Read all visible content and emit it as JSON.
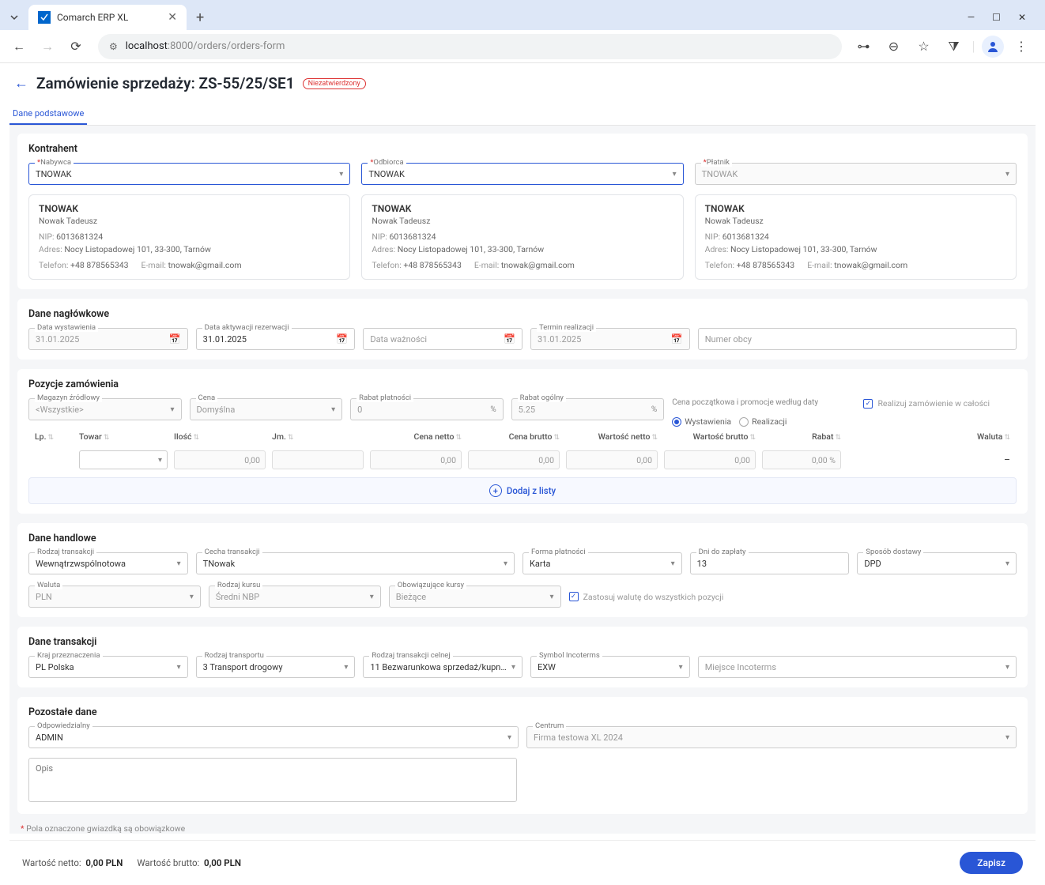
{
  "browser": {
    "tab_title": "Comarch ERP XL",
    "url_host": "localhost",
    "url_port": ":8000",
    "url_path": "/orders/orders-form"
  },
  "header": {
    "title": "Zamówienie sprzedaży: ZS-55/25/SE1",
    "badge": "Niezatwierdzony",
    "tab": "Dane podstawowe"
  },
  "kontrahent": {
    "title": "Kontrahent",
    "nabywca_label": "Nabywca",
    "odbiorca_label": "Odbiorca",
    "platnik_label": "Płatnik",
    "value": "TNOWAK",
    "card": {
      "name": "TNOWAK",
      "person": "Nowak Tadeusz",
      "nip_lbl": "NIP:",
      "nip": "6013681324",
      "adres_lbl": "Adres:",
      "adres": "Nocy Listopadowej 101, 33-300, Tarnów",
      "tel_lbl": "Telefon:",
      "tel": "+48 878565343",
      "email_lbl": "E-mail:",
      "email": "tnowak@gmail.com"
    }
  },
  "naglowkowe": {
    "title": "Dane nagłówkowe",
    "data_wyst_lbl": "Data wystawienia",
    "data_wyst": "31.01.2025",
    "data_akt_lbl": "Data aktywacji rezerwacji",
    "data_akt": "31.01.2025",
    "data_wazn_lbl": "Data ważności",
    "termin_lbl": "Termin realizacji",
    "termin": "31.01.2025",
    "numer_obcy_ph": "Numer obcy"
  },
  "pozycje": {
    "title": "Pozycje zamówienia",
    "magazyn_lbl": "Magazyn źródłowy",
    "magazyn": "<Wszystkie>",
    "cena_lbl": "Cena",
    "cena": "Domyślna",
    "rabat_p_lbl": "Rabat płatności",
    "rabat_p": "0",
    "rabat_o_lbl": "Rabat ogólny",
    "rabat_o": "5.25",
    "promo_title": "Cena początkowa i promocje według daty",
    "r_wyst": "Wystawienia",
    "r_real": "Realizacji",
    "realizuj": "Realizuj zamówienie w całości",
    "cols": {
      "lp": "Lp.",
      "towar": "Towar",
      "ilosc": "Ilość",
      "jm": "Jm.",
      "cn": "Cena netto",
      "cb": "Cena brutto",
      "wn": "Wartość netto",
      "wb": "Wartość brutto",
      "rabat": "Rabat",
      "waluta": "Waluta"
    },
    "row": {
      "ilosc": "0,00",
      "cn": "0,00",
      "cb": "0,00",
      "wn": "0,00",
      "wb": "0,00",
      "rabat": "0,00 %",
      "waluta": "–"
    },
    "add": "Dodaj z listy"
  },
  "handlowe": {
    "title": "Dane handlowe",
    "rodzaj_t_lbl": "Rodzaj transakcji",
    "rodzaj_t": "Wewnątrzwspólnotowa",
    "cecha_lbl": "Cecha transakcji",
    "cecha": "TNowak",
    "forma_lbl": "Forma płatności",
    "forma": "Karta",
    "dni_lbl": "Dni do zapłaty",
    "dni": "13",
    "sposob_lbl": "Sposób dostawy",
    "sposob": "DPD",
    "waluta_lbl": "Waluta",
    "waluta": "PLN",
    "kurs_lbl": "Rodzaj kursu",
    "kurs": "Średni NBP",
    "obow_lbl": "Obowiązujące kursy",
    "obow": "Bieżące",
    "zastosuj": "Zastosuj walutę do wszystkich pozycji"
  },
  "transakcji": {
    "title": "Dane transakcji",
    "kraj_lbl": "Kraj przeznaczenia",
    "kraj": "PL Polska",
    "transport_lbl": "Rodzaj transportu",
    "transport": "3 Transport drogowy",
    "celna_lbl": "Rodzaj transakcji celnej",
    "celna": "11 Bezwarunkowa sprzedaż/kupno …",
    "symbol_lbl": "Symbol Incoterms",
    "symbol": "EXW",
    "miejsce_ph": "Miejsce Incoterms"
  },
  "pozostale": {
    "title": "Pozostałe dane",
    "odp_lbl": "Odpowiedzialny",
    "odp": "ADMIN",
    "centrum_lbl": "Centrum",
    "centrum": "Firma testowa XL 2024",
    "opis_ph": "Opis"
  },
  "footnote": {
    "star": "*",
    "text": "Pola oznaczone gwiazdką są obowiązkowe"
  },
  "footer": {
    "wn_lbl": "Wartość netto:",
    "wn": "0,00 PLN",
    "wb_lbl": "Wartość brutto:",
    "wb": "0,00 PLN",
    "save": "Zapisz"
  }
}
